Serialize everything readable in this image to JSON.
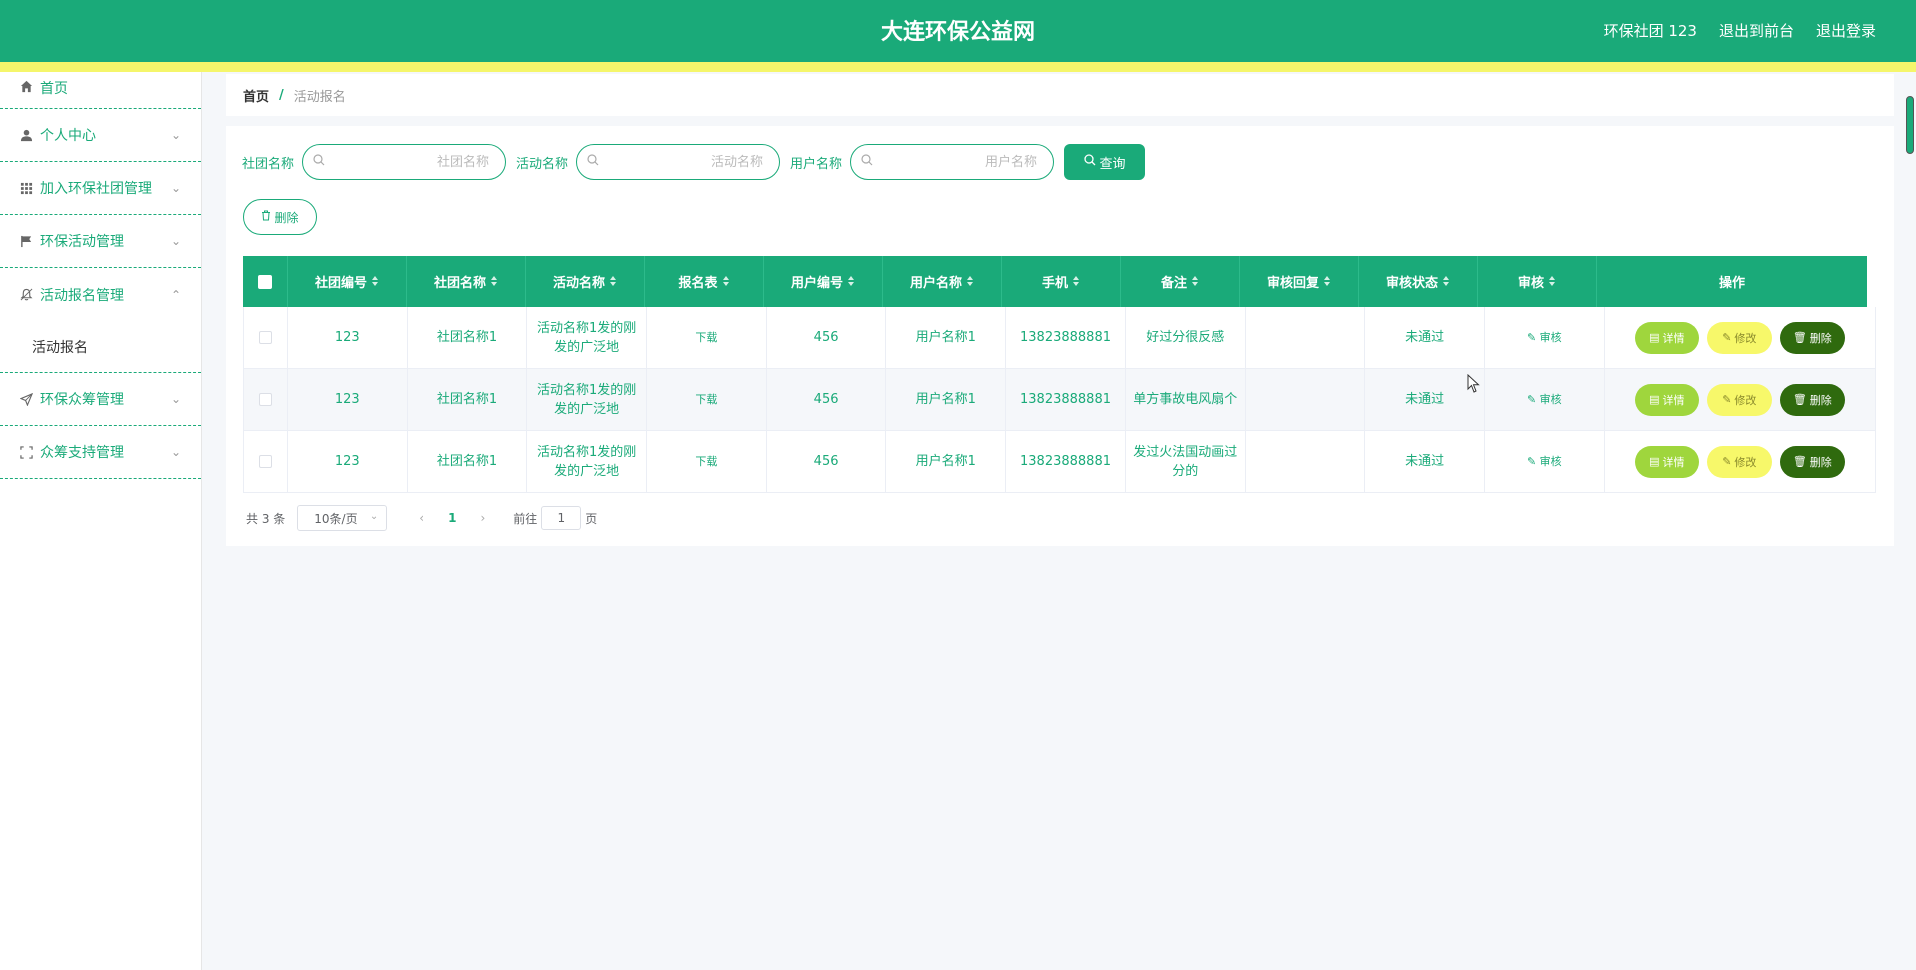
{
  "header": {
    "site_title": "大连环保公益网",
    "user_label": "环保社团 123",
    "to_front_label": "退出到前台",
    "logout_label": "退出登录"
  },
  "sidebar": {
    "items": [
      {
        "label": "首页",
        "icon": "home-icon"
      },
      {
        "label": "个人中心",
        "icon": "user-icon"
      },
      {
        "label": "加入环保社团管理",
        "icon": "grid-icon"
      },
      {
        "label": "环保活动管理",
        "icon": "flag-icon"
      },
      {
        "label": "活动报名管理",
        "icon": "bell-icon"
      },
      {
        "label": "环保众筹管理",
        "icon": "send-icon"
      },
      {
        "label": "众筹支持管理",
        "icon": "fullscreen-icon"
      }
    ],
    "submenu_active": "活动报名"
  },
  "breadcrumb": {
    "home": "首页",
    "separator": "/",
    "current": "活动报名"
  },
  "search": {
    "club_label": "社团名称",
    "club_placeholder": "社团名称",
    "activity_label": "活动名称",
    "activity_placeholder": "活动名称",
    "user_label": "用户名称",
    "user_placeholder": "用户名称",
    "query_button": "查询"
  },
  "toolbar": {
    "delete_label": "删除"
  },
  "table": {
    "columns": [
      "社团编号",
      "社团名称",
      "活动名称",
      "报名表",
      "用户编号",
      "用户名称",
      "手机",
      "备注",
      "审核回复",
      "审核状态",
      "审核",
      "操作"
    ],
    "rows": [
      {
        "club_no": "123",
        "club_name": "社团名称1",
        "activity": "活动名称1发的刚发的广泛地",
        "form": "下载",
        "user_no": "456",
        "user_name": "用户名称1",
        "phone": "13823888881",
        "remark": "好过分很反感",
        "reply": "",
        "status": "未通过",
        "audit": "审核"
      },
      {
        "club_no": "123",
        "club_name": "社团名称1",
        "activity": "活动名称1发的刚发的广泛地",
        "form": "下载",
        "user_no": "456",
        "user_name": "用户名称1",
        "phone": "13823888881",
        "remark": "单方事故电风扇个",
        "reply": "",
        "status": "未通过",
        "audit": "审核"
      },
      {
        "club_no": "123",
        "club_name": "社团名称1",
        "activity": "活动名称1发的刚发的广泛地",
        "form": "下载",
        "user_no": "456",
        "user_name": "用户名称1",
        "phone": "13823888881",
        "remark": "发过火法国动画过分的",
        "reply": "",
        "status": "未通过",
        "audit": "审核"
      }
    ],
    "op_detail": "详情",
    "op_edit": "修改",
    "op_delete": "删除"
  },
  "pagination": {
    "total": "共 3 条",
    "page_size": "10条/页",
    "current_page": "1",
    "goto_label": "前往",
    "goto_value": "1",
    "page_suffix": "页"
  },
  "colors": {
    "primary": "#1aaa79",
    "accent_bar": "#f5f66b",
    "detail_btn": "#9fd63d",
    "edit_btn": "#f7f86a",
    "delete_btn": "#2f6a0e"
  }
}
